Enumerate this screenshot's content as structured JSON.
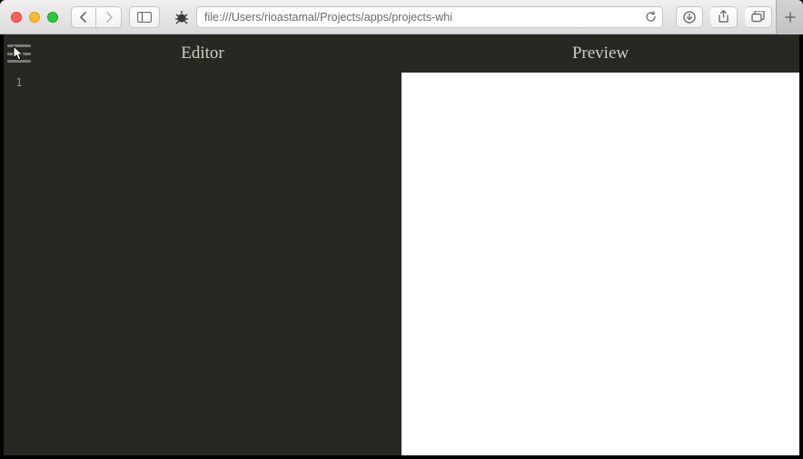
{
  "browser": {
    "url": "file:///Users/rioastamal/Projects/apps/projects-whi"
  },
  "app": {
    "header": {
      "editor_label": "Editor",
      "preview_label": "Preview"
    },
    "editor": {
      "line_number": "1"
    }
  }
}
